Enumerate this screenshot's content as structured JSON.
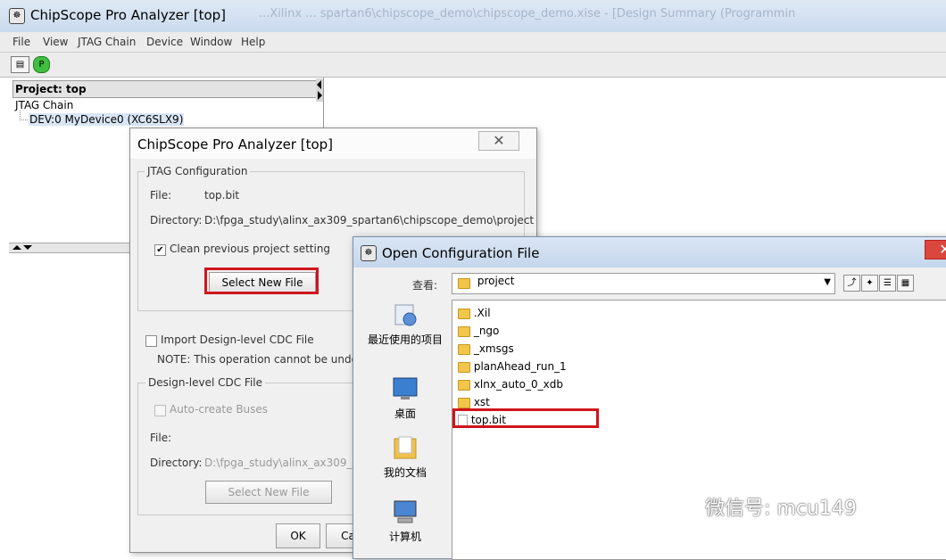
{
  "main_window": {
    "title": "ChipScope Pro Analyzer [top]",
    "background_title": "...Xilinx ... spartan6\\chipscope_demo\\chipscope_demo.xise - [Design Summary (Programmin"
  },
  "menubar": {
    "items": [
      "File",
      "View",
      "JTAG Chain",
      "Device",
      "Window",
      "Help"
    ]
  },
  "toolbar": {
    "buttons": [
      {
        "icon": "jtag-chain-icon"
      },
      {
        "icon": "green-p-icon",
        "label": "P"
      }
    ]
  },
  "project_panel": {
    "header": "Project: top",
    "tree_root": "JTAG Chain",
    "tree_child": "DEV:0 MyDevice0 (XC6SLX9)"
  },
  "config_dialog": {
    "title": "ChipScope Pro Analyzer [top]",
    "close_glyph": "✕",
    "jtag_group": {
      "legend": "JTAG Configuration",
      "file_label": "File:",
      "file_value": "top.bit",
      "dir_label": "Directory:",
      "dir_value": "D:\\fpga_study\\alinx_ax309_spartan6\\chipscope_demo\\project",
      "clean_checkbox": "Clean previous project setting",
      "clean_checked": true,
      "select_button": "Select New File"
    },
    "import_checkbox": "Import Design-level CDC File",
    "note": "NOTE: This operation cannot be undone",
    "cdc_group": {
      "legend": "Design-level CDC File",
      "auto_create": "Auto-create Buses",
      "file_label": "File:",
      "dir_label": "Directory:",
      "dir_value": "D:\\fpga_study\\alinx_ax309_spa",
      "select_button": "Select New File"
    },
    "ok_button": "OK",
    "cancel_button": "Ca"
  },
  "open_dialog": {
    "title": "Open Configuration File",
    "lookin_label": "查看:",
    "lookin_value": "project",
    "places": [
      "最近使用的项目",
      "桌面",
      "我的文档",
      "计算机"
    ],
    "files": [
      {
        "name": ".Xil",
        "type": "folder"
      },
      {
        "name": "_ngo",
        "type": "folder"
      },
      {
        "name": "_xmsgs",
        "type": "folder"
      },
      {
        "name": "planAhead_run_1",
        "type": "folder"
      },
      {
        "name": "xlnx_auto_0_xdb",
        "type": "folder"
      },
      {
        "name": "xst",
        "type": "folder"
      },
      {
        "name": "top.bit",
        "type": "file"
      }
    ]
  },
  "watermark": "微信号: mcu149",
  "colors": {
    "highlight_red": "#d0151d",
    "selection": "#d9e6f5",
    "title_blue": "#c9daee"
  }
}
